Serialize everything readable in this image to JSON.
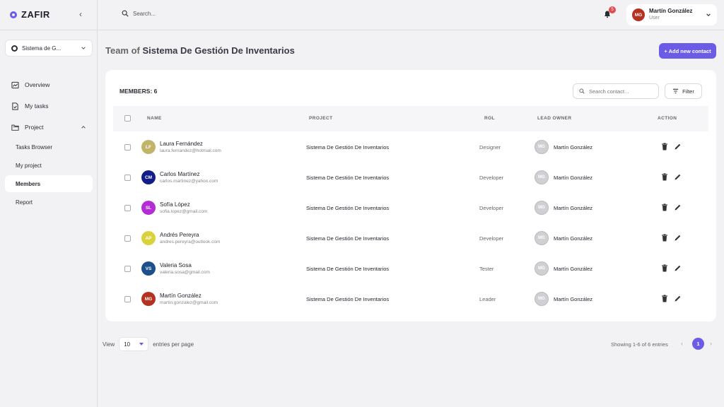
{
  "brand": {
    "name": "ZAFIR"
  },
  "sidebar": {
    "project_select": "Sistema de G...",
    "nav": [
      {
        "label": "Overview",
        "icon": "chart-icon"
      },
      {
        "label": "My tasks",
        "icon": "tasks-icon"
      },
      {
        "label": "Project",
        "icon": "folder-icon"
      }
    ],
    "sub": [
      {
        "label": "Tasks Browser"
      },
      {
        "label": "My project"
      },
      {
        "label": "Members",
        "active": true
      },
      {
        "label": "Report"
      }
    ]
  },
  "topbar": {
    "search_placeholder": "Search...",
    "notifications": "5",
    "user": {
      "initials": "MG",
      "name": "Martín González",
      "role": "User"
    }
  },
  "header": {
    "title_prefix": "Team of",
    "title_project": "Sistema De Gestión De Inventarios",
    "add_button": "+ Add new contact"
  },
  "card": {
    "members_label": "MEMBERS: 6",
    "search_placeholder": "Search contact...",
    "filter_label": "Filter",
    "columns": {
      "name": "NAME",
      "project": "PROJECT",
      "rol": "ROL",
      "lead": "LEAD OWNER",
      "action": "ACTION"
    },
    "rows": [
      {
        "initials": "LF",
        "color": "#c2b36a",
        "name": "Laura Fernández",
        "email": "laura.fernandez@hotmail.com",
        "project": "Sistema De Gestión De Inventarios",
        "rol": "Designer",
        "lead_initials": "MG",
        "lead": "Martín González"
      },
      {
        "initials": "CM",
        "color": "#131d8a",
        "name": "Carlos Martínez",
        "email": "carlos.martinez@yahoo.com",
        "project": "Sistema De Gestión De Inventarios",
        "rol": "Developer",
        "lead_initials": "MG",
        "lead": "Martín González"
      },
      {
        "initials": "SL",
        "color": "#b52bd6",
        "name": "Sofía López",
        "email": "sofia.lopez@gmail.com",
        "project": "Sistema De Gestión De Inventarios",
        "rol": "Developer",
        "lead_initials": "MG",
        "lead": "Martín González"
      },
      {
        "initials": "AP",
        "color": "#d9d23a",
        "name": "Andrés Pereyra",
        "email": "andres.pereyra@outlook.com",
        "project": "Sistema De Gestión De Inventarios",
        "rol": "Developer",
        "lead_initials": "MG",
        "lead": "Martín González"
      },
      {
        "initials": "VS",
        "color": "#1d4f8c",
        "name": "Valeria Sosa",
        "email": "valeria.sosa@gmail.com",
        "project": "Sistema De Gestión De Inventarios",
        "rol": "Tester",
        "lead_initials": "MG",
        "lead": "Martín González"
      },
      {
        "initials": "MG",
        "color": "#b4321f",
        "name": "Martín González",
        "email": "martin.gonzalez@gmail.com",
        "project": "Sistema De Gestión De Inventarios",
        "rol": "Leader",
        "lead_initials": "MG",
        "lead": "Martín González"
      }
    ]
  },
  "footer": {
    "view_label": "View",
    "entries_value": "10",
    "entries_suffix": "entries per page",
    "showing": "Showing 1-6 of 6 entries",
    "current_page": "1"
  },
  "colors": {
    "accent": "#6b5ce7",
    "badge": "#e5484d"
  }
}
